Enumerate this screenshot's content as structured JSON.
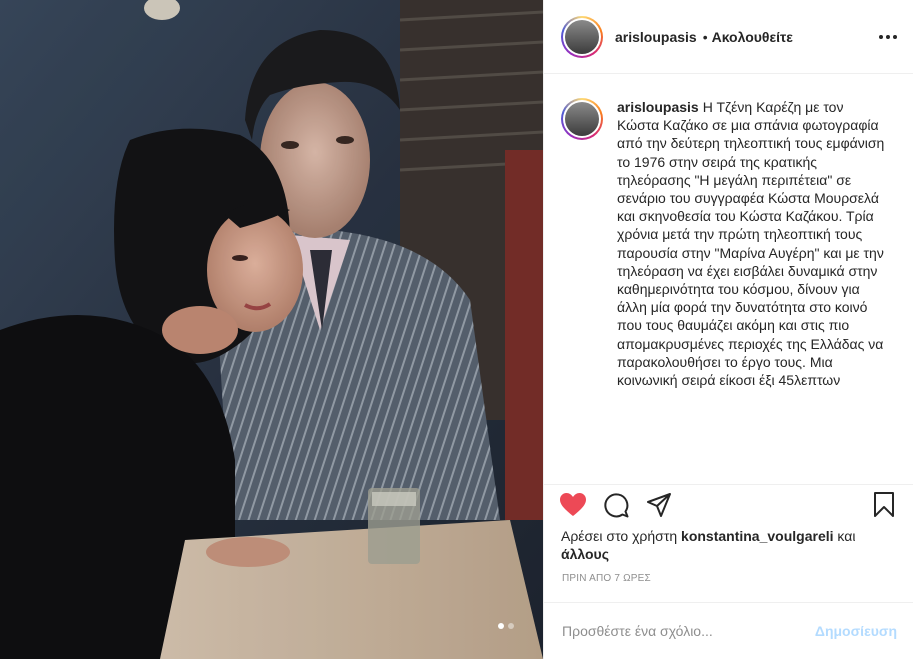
{
  "post": {
    "username": "arisloupasis",
    "follow_status": "Ακολουθείτε",
    "separator": "•",
    "caption": "Η Τζένη Καρέζη με τον Κώστα Καζάκο σε μια σπάνια φωτογραφία από την δεύτερη τηλεοπτική τους εμφάνιση το 1976 στην σειρά της κρατικής τηλεόρασης \"Η μεγάλη περιπέτεια\" σε σενάριο του συγγραφέα Κώστα Μουρσελά και σκηνοθεσία του Κώστα Καζάκου. Τρία χρόνια μετά την πρώτη τηλεοπτική τους παρουσία στην \"Μαρίνα Αυγέρη\" και με την τηλεόραση να έχει εισβάλει δυναμικά στην καθημερινότητα του κόσμου, δίνουν για άλλη μία φορά την δυνατότητα στο κοινό που τους θαυμάζει ακόμη και στις πιο απομακρυσμένες περιοχές της Ελλάδας να παρακολουθήσει το έργο τους. Μια κοινωνική σειρά είκοσι έξι 45λεπτων"
  },
  "likes": {
    "prefix": "Αρέσει στο χρήστη",
    "user": "konstantina_voulgareli",
    "joiner": "και",
    "others": "άλλους"
  },
  "timestamp": "ΠΡΙΝ ΑΠΟ 7 ΩΡΕΣ",
  "comment": {
    "placeholder": "Προσθέστε ένα σχόλιο...",
    "post_label": "Δημοσίευση"
  },
  "carousel": {
    "count": 2,
    "active": 0
  },
  "colors": {
    "like_red": "#ed4956",
    "post_disabled": "#b3dbff",
    "muted": "#8e8e8e"
  },
  "icons": [
    "heart-icon",
    "comment-icon",
    "share-icon",
    "bookmark-icon",
    "more-icon"
  ]
}
